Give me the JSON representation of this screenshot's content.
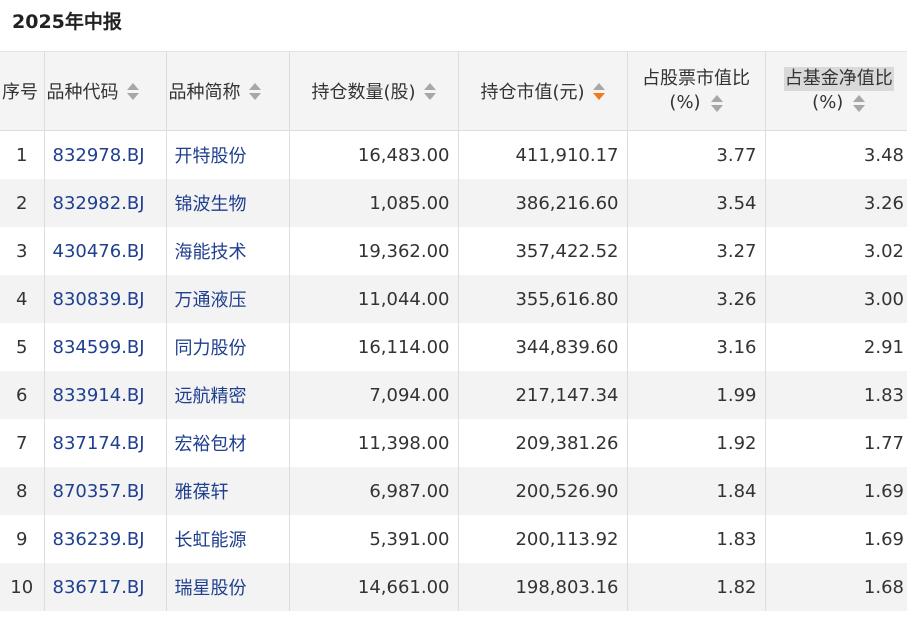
{
  "title": "2025年中报",
  "colors": {
    "link": "#1f3f8f",
    "sort_active": "#f07a1c",
    "sort_idle": "#a7a7a7",
    "header_bg": "#f4f4f4",
    "stripe_bg": "#f3f3f3"
  },
  "headers": {
    "idx": "序号",
    "code": "品种代码",
    "name": "品种简称",
    "qty": "持仓数量(股)",
    "value": "持仓市值(元)",
    "stock_pct_line1": "占股票市值比",
    "stock_pct_line2": "(%)",
    "fund_pct_line1": "占基金净值比",
    "fund_pct_line2": "(%)"
  },
  "rows": [
    {
      "idx": "1",
      "code": "832978.BJ",
      "name": "开特股份",
      "qty": "16,483.00",
      "value": "411,910.17",
      "stock_pct": "3.77",
      "fund_pct": "3.48"
    },
    {
      "idx": "2",
      "code": "832982.BJ",
      "name": "锦波生物",
      "qty": "1,085.00",
      "value": "386,216.60",
      "stock_pct": "3.54",
      "fund_pct": "3.26"
    },
    {
      "idx": "3",
      "code": "430476.BJ",
      "name": "海能技术",
      "qty": "19,362.00",
      "value": "357,422.52",
      "stock_pct": "3.27",
      "fund_pct": "3.02"
    },
    {
      "idx": "4",
      "code": "830839.BJ",
      "name": "万通液压",
      "qty": "11,044.00",
      "value": "355,616.80",
      "stock_pct": "3.26",
      "fund_pct": "3.00"
    },
    {
      "idx": "5",
      "code": "834599.BJ",
      "name": "同力股份",
      "qty": "16,114.00",
      "value": "344,839.60",
      "stock_pct": "3.16",
      "fund_pct": "2.91"
    },
    {
      "idx": "6",
      "code": "833914.BJ",
      "name": "远航精密",
      "qty": "7,094.00",
      "value": "217,147.34",
      "stock_pct": "1.99",
      "fund_pct": "1.83"
    },
    {
      "idx": "7",
      "code": "837174.BJ",
      "name": "宏裕包材",
      "qty": "11,398.00",
      "value": "209,381.26",
      "stock_pct": "1.92",
      "fund_pct": "1.77"
    },
    {
      "idx": "8",
      "code": "870357.BJ",
      "name": "雅葆轩",
      "qty": "6,987.00",
      "value": "200,526.90",
      "stock_pct": "1.84",
      "fund_pct": "1.69"
    },
    {
      "idx": "9",
      "code": "836239.BJ",
      "name": "长虹能源",
      "qty": "5,391.00",
      "value": "200,113.92",
      "stock_pct": "1.83",
      "fund_pct": "1.69"
    },
    {
      "idx": "10",
      "code": "836717.BJ",
      "name": "瑞星股份",
      "qty": "14,661.00",
      "value": "198,803.16",
      "stock_pct": "1.82",
      "fund_pct": "1.68"
    }
  ]
}
